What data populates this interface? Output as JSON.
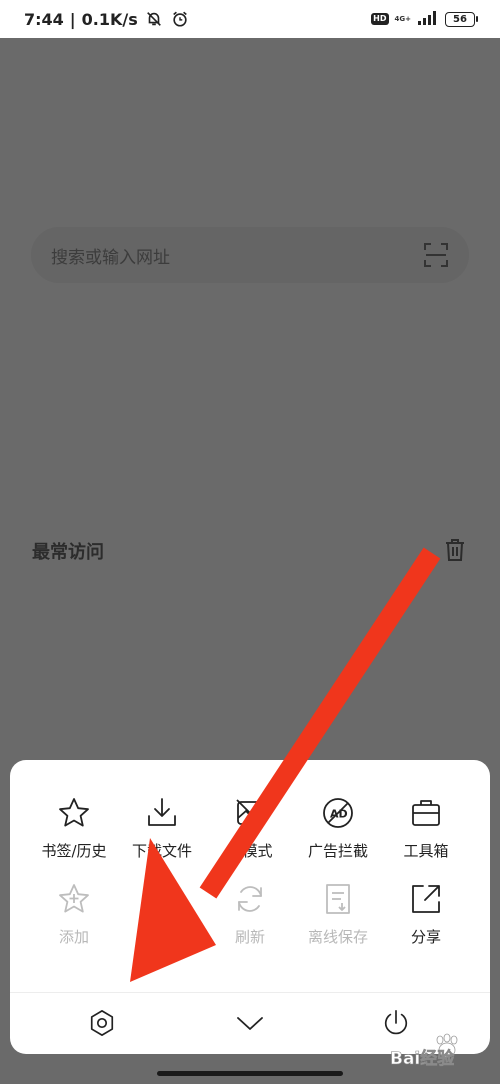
{
  "status_bar": {
    "time": "7:44",
    "speed": "0.1K/s",
    "hd": "HD",
    "network": "4G+",
    "battery": "56"
  },
  "page": {
    "search_placeholder": "搜索或输入网址",
    "most_visited_title": "最常访问"
  },
  "menu": {
    "row1": [
      {
        "label": "书签/历史",
        "icon": "star-icon"
      },
      {
        "label": "下载文件",
        "icon": "download-icon"
      },
      {
        "label": "图模式",
        "icon": "no-image-icon"
      },
      {
        "label": "广告拦截",
        "icon": "ad-block-icon"
      },
      {
        "label": "工具箱",
        "icon": "toolbox-icon"
      }
    ],
    "row2": [
      {
        "label": "添加",
        "icon": "add-bookmark-icon"
      },
      {
        "label": "",
        "icon": "night-mode-icon"
      },
      {
        "label": "刷新",
        "icon": "refresh-icon"
      },
      {
        "label": "离线保存",
        "icon": "offline-save-icon"
      },
      {
        "label": "分享",
        "icon": "share-icon"
      }
    ]
  },
  "bottom_bar": [
    "settings-icon",
    "collapse-chevron-icon",
    "exit-power-icon"
  ],
  "annotation_color": "#f0361c",
  "watermark_text": "Bai经验"
}
